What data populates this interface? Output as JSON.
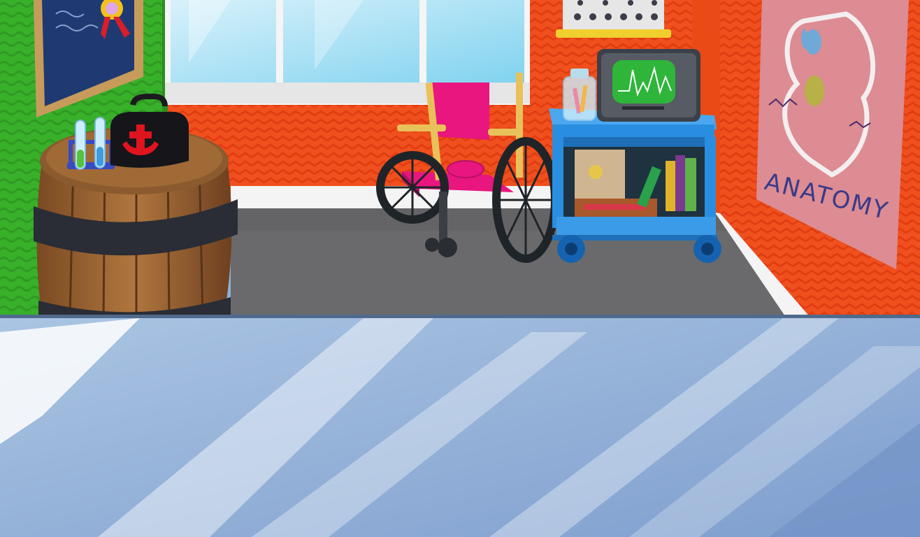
{
  "scene": {
    "poster": {
      "text": "ANATOMY"
    }
  },
  "colors": {
    "left_wall": "#38b02a",
    "back_wall": "#f0501e",
    "right_wall": "#f25a20",
    "floor": "#6a6a6c",
    "wheelchair_seat": "#e8167e",
    "cart": "#2a8ee0",
    "monitor_screen": "#2eb53a",
    "counter": "#8fb0d8"
  }
}
